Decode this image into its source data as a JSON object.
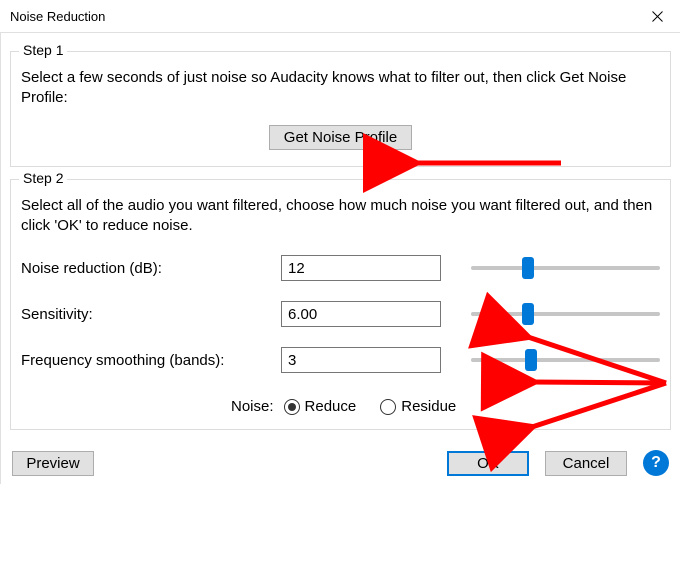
{
  "window": {
    "title": "Noise Reduction"
  },
  "step1": {
    "legend": "Step 1",
    "instruction": "Select a few seconds of just noise so Audacity knows what to filter out, then click Get Noise Profile:",
    "button": "Get Noise Profile"
  },
  "step2": {
    "legend": "Step 2",
    "instruction": "Select all of the audio you want filtered, choose how much noise you want filtered out, and then click 'OK' to reduce noise.",
    "params": {
      "noise_reduction": {
        "label": "Noise reduction (dB):",
        "value": "12",
        "slider_pct": 30
      },
      "sensitivity": {
        "label": "Sensitivity:",
        "value": "6.00",
        "slider_pct": 30
      },
      "freq_smoothing": {
        "label": "Frequency smoothing (bands):",
        "value": "3",
        "slider_pct": 32
      }
    },
    "noise_label": "Noise:",
    "radio_reduce": "Reduce",
    "radio_residue": "Residue",
    "radio_selected": "reduce"
  },
  "footer": {
    "preview": "Preview",
    "ok": "OK",
    "cancel": "Cancel"
  },
  "annotations": {
    "arrow_color": "#ff0000"
  }
}
